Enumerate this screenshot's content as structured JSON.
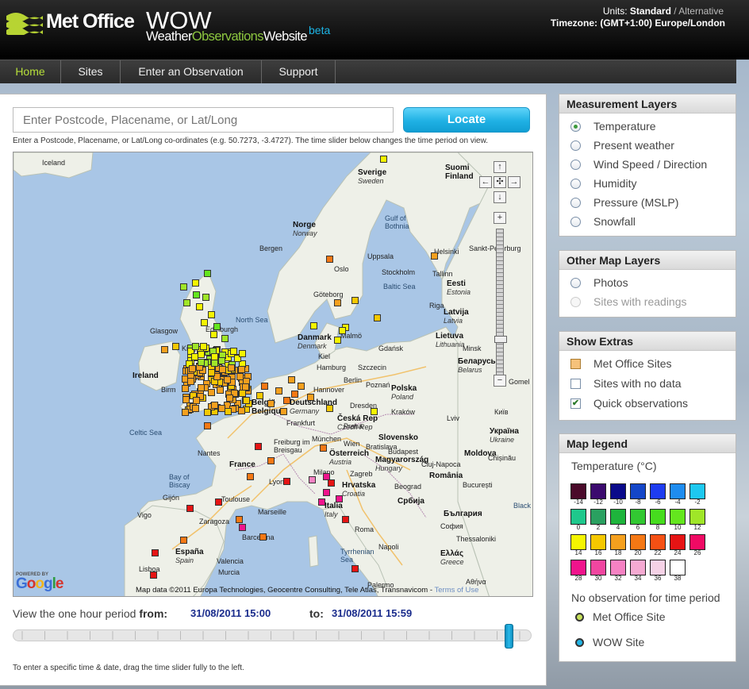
{
  "header": {
    "brand": "Met Office",
    "wow_title": "WOW",
    "wow_sub_1": "Weather",
    "wow_sub_2": "Observations",
    "wow_sub_3": "Website",
    "wow_beta": "beta",
    "units_label": "Units:",
    "units_current": "Standard",
    "units_sep": "/",
    "units_alt": "Alternative",
    "timezone": "Timezone: (GMT+1:00) Europe/London"
  },
  "nav": {
    "items": [
      "Home",
      "Sites",
      "Enter an Observation",
      "Support"
    ]
  },
  "search": {
    "placeholder": "Enter Postcode, Placename, or Lat/Long",
    "button": "Locate",
    "hint": "Enter a Postcode, Placename, or Lat/Long co-ordinates (e.g. 50.7273, -3.4727). The time slider below changes the time period on view."
  },
  "map": {
    "labels": {
      "iceland": "Iceland",
      "sverige": "Sverige",
      "sverige_en": "Sweden",
      "suomi": "Suomi",
      "finland": "Finland",
      "norge": "Norge",
      "norway": "Norway",
      "gulf": "Gulf of",
      "bothnia": "Bothnia",
      "bergen": "Bergen",
      "uppsala": "Uppsala",
      "helsinki": "Helsinki",
      "spb": "Sankt-Peterburg",
      "oslo": "Oslo",
      "stockholm": "Stockholm",
      "tallinn": "Tallinn",
      "eesti": "Eesti",
      "estonia": "Estonia",
      "baltic": "Baltic Sea",
      "goteborg": "Göteborg",
      "riga": "Riga",
      "latvija": "Latvija",
      "latvia": "Latvia",
      "north_sea": "North Sea",
      "glasgow": "Glasgow",
      "edinburgh": "Edinburgh",
      "danmark": "Danmark",
      "denmark": "Denmark",
      "malmo": "Malmö",
      "lietuva": "Lietuva",
      "lithuania": "Lithuania",
      "gdansk": "Gdańsk",
      "minsk": "Minsk",
      "king": "King",
      "kiel": "Kiel",
      "belarus": "Беларусь",
      "belarus_en": "Belarus",
      "ireland": "Ireland",
      "hamburg": "Hamburg",
      "szczecin": "Szczecin",
      "birm": "Birm",
      "hannover": "Hannover",
      "polska": "Polska",
      "poland": "Poland",
      "berlin": "Berlin",
      "poznan": "Poznań",
      "gomel": "Gomel",
      "belgie": "België",
      "belgium": "Belgique",
      "deutschland": "Deutschland",
      "germany": "Germany",
      "dresden": "Dresden",
      "krakow": "Kraków",
      "ceska": "Česká Rep",
      "czech": "Czech Rep",
      "lviv": "Lviv",
      "ukraina": "Україна",
      "ukraine": "Ukraine",
      "celtic": "Celtic Sea",
      "frankfurt": "Frankfurt",
      "praha": "Praha",
      "slovensko": "Slovensko",
      "chisinau": "Chișinău",
      "munchen": "München",
      "freiburg": "Freiburg im",
      "breisgau": "Breisgau",
      "osterreich": "Österreich",
      "austria": "Austria",
      "magyar": "Magyarország",
      "hungary": "Hungary",
      "moldova": "Moldova",
      "nantes": "Nantes",
      "france": "France",
      "bay": "Bay of",
      "biscay": "Biscay",
      "lyon": "Lyon",
      "milano": "Milano",
      "zagreb": "Zagreb",
      "hrvatska": "Hrvatska",
      "croatia": "Croatia",
      "romania": "România",
      "beograd": "Beograd",
      "bucuresti": "București",
      "gijon": "Gijón",
      "toulouse": "Toulouse",
      "marseille": "Marseille",
      "italia": "Italia",
      "italy": "Italy",
      "srbija": "Србија",
      "bulgaria": "България",
      "black": "Black",
      "vigo": "Vigo",
      "zaragoza": "Zaragoza",
      "barcelona": "Barcelona",
      "sofia": "София",
      "espana": "España",
      "spain": "Spain",
      "roma": "Roma",
      "napoli": "Napoli",
      "tyrrhenian": "Tyrrhenian",
      "sea": "Sea",
      "ellas": "Ελλάς",
      "greece": "Greece",
      "lisboa": "Lisboa",
      "valencia": "Valencia",
      "murcia": "Murcia",
      "athina": "Αθήνα",
      "thessaloniki": "Thessaloniki",
      "bratislava": "Bratislava",
      "wien": "Wien",
      "budapest": "Budapest",
      "kyiv": "Київ",
      "cluj": "Cluj-Napoca",
      "palermo": "Palermo"
    },
    "attribution": "Map data ©2011 Europa Technologies, Geocentre Consulting, Tele Atlas, Transnavicom -",
    "terms": "Terms of Use",
    "powered_by": "POWERED BY",
    "google": "Google",
    "controls": {
      "up": "↑",
      "left": "←",
      "center": "✣",
      "right": "→",
      "down": "↓",
      "zoom_in": "+",
      "zoom_out": "−"
    }
  },
  "time": {
    "view_label": "View the one hour period",
    "from_label": "from:",
    "from_value": "31/08/2011 15:00",
    "to_label": "to:",
    "to_value": "31/08/2011 15:59",
    "slider_position": 0.965,
    "hint": "To enter a specific time & date, drag the time slider fully to the left."
  },
  "measurement_layers": {
    "title": "Measurement Layers",
    "options": [
      "Temperature",
      "Present weather",
      "Wind Speed / Direction",
      "Humidity",
      "Pressure (MSLP)",
      "Snowfall"
    ],
    "selected": "Temperature"
  },
  "other_layers": {
    "title": "Other Map Layers",
    "options": [
      "Photos",
      "Sites with readings"
    ]
  },
  "extras": {
    "title": "Show Extras",
    "options": [
      "Met Office Sites",
      "Sites with no data",
      "Quick observations"
    ]
  },
  "legend": {
    "title": "Map legend",
    "subtitle": "Temperature (°C)",
    "row1_labels": [
      "-14",
      "-12",
      "-10",
      "-8",
      "-6",
      "-4",
      "-2"
    ],
    "row2_labels": [
      "0",
      "2",
      "4",
      "6",
      "8",
      "10",
      "12"
    ],
    "row3_labels": [
      "14",
      "16",
      "18",
      "20",
      "22",
      "24",
      "26"
    ],
    "row4_labels": [
      "28",
      "30",
      "32",
      "34",
      "36",
      "38"
    ],
    "row1_colors": [
      "#4a0a2a",
      "#3b0a6e",
      "#0a0a8a",
      "#1446c8",
      "#1e3cf0",
      "#1e8cf0",
      "#1ec8f0"
    ],
    "row2_colors": [
      "#1ec88c",
      "#2aa060",
      "#1eb43c",
      "#32c832",
      "#46dc1e",
      "#64e61e",
      "#a0e628"
    ],
    "row3_colors": [
      "#f5f500",
      "#f5c800",
      "#f5a01e",
      "#f57814",
      "#f55014",
      "#e61414",
      "#f00a64"
    ],
    "row4_colors": [
      "#f0148c",
      "#f046a0",
      "#f582c3",
      "#f5aad2",
      "#f5d2e6",
      "#ffffff"
    ],
    "no_obs": "No observation for time period",
    "met_office_site": "Met Office Site",
    "wow_site": "WOW Site"
  }
}
